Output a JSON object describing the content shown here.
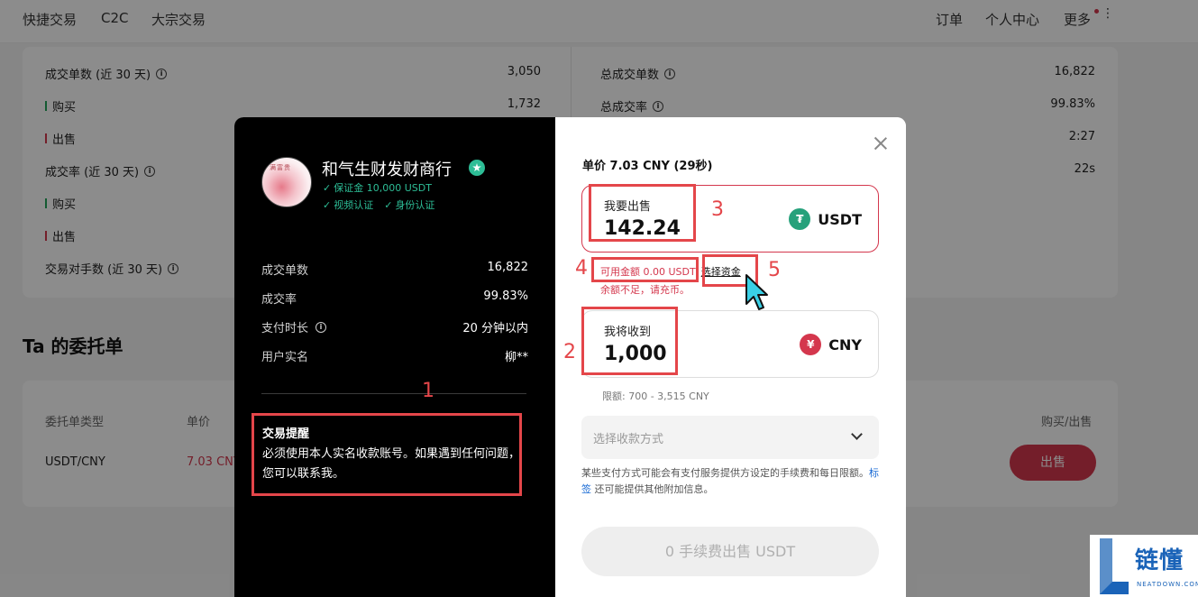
{
  "topnav": {
    "left": [
      "快捷交易",
      "C2C",
      "大宗交易"
    ],
    "right": [
      "订单",
      "个人中心",
      "更多"
    ]
  },
  "stats": {
    "left": [
      {
        "label": "成交单数 (近 30 天)",
        "value": "3,050",
        "info": true
      },
      {
        "label": "购买",
        "value": "1,732",
        "mark": "green"
      },
      {
        "label": "出售",
        "value": "",
        "mark": "red"
      },
      {
        "label": "成交率 (近 30 天)",
        "value": "",
        "info": true
      },
      {
        "label": "购买",
        "value": "",
        "mark": "green"
      },
      {
        "label": "出售",
        "value": "",
        "mark": "red"
      },
      {
        "label": "交易对手数 (近 30 天)",
        "value": "",
        "info": true
      }
    ],
    "right": [
      {
        "label": "总成交单数",
        "value": "16,822",
        "info": true
      },
      {
        "label": "总成交率",
        "value": "99.83%",
        "info": true
      },
      {
        "label": "",
        "value": "2:27"
      },
      {
        "label": "",
        "value": "22s"
      }
    ]
  },
  "orders": {
    "title": "Ta 的委托单",
    "headers": {
      "type": "委托单类型",
      "price": "单价",
      "action": "购买/出售"
    },
    "row": {
      "type": "USDT/CNY",
      "price": "7.03 CNY",
      "action_label": "出售"
    }
  },
  "merchant": {
    "name": "和气生财发财商行",
    "avatar_text": "满富贵",
    "deposit": "保证金 10,000 USDT",
    "video_verified": "视频认证",
    "id_verified": "身份认证",
    "stats": [
      {
        "label": "成交单数",
        "value": "16,822",
        "info": false
      },
      {
        "label": "成交率",
        "value": "99.83%",
        "info": false
      },
      {
        "label": "支付时长",
        "value": "20 分钟以内",
        "info": true
      },
      {
        "label": "用户实名",
        "value": "柳**",
        "info": false
      }
    ],
    "reminder_title": "交易提醒",
    "reminder_text": "必须使用本人实名收款账号。如果遇到任何问题，您可以联系我。"
  },
  "trade": {
    "unit_price": "单价 7.03 CNY (29秒)",
    "sell_label": "我要出售",
    "sell_amount": "142.24",
    "sell_currency": "USDT",
    "available": "可用金额 0.00 USDT",
    "choose_funds": "选择资金",
    "insufficient": "余额不足，请充币。",
    "receive_label": "我将收到",
    "receive_amount": "1,000",
    "receive_currency": "CNY",
    "limit": "限额: 700 - 3,515 CNY",
    "payment_placeholder": "选择收款方式",
    "note_before": "某些支付方式可能会有支付服务提供方设定的手续费和每日限额。",
    "note_link": "标签",
    "note_after": " 还可能提供其他附加信息。",
    "submit": "0 手续费出售 USDT"
  },
  "annotations": [
    "1",
    "2",
    "3",
    "4",
    "5"
  ],
  "watermark": {
    "brand": "链懂",
    "domain": "NEATDOWN.COM"
  },
  "colors": {
    "accent_red": "#d4374d",
    "annotation_red": "#e4464a",
    "usdt_green": "#26a17b",
    "verified_teal": "#2dbd96"
  }
}
